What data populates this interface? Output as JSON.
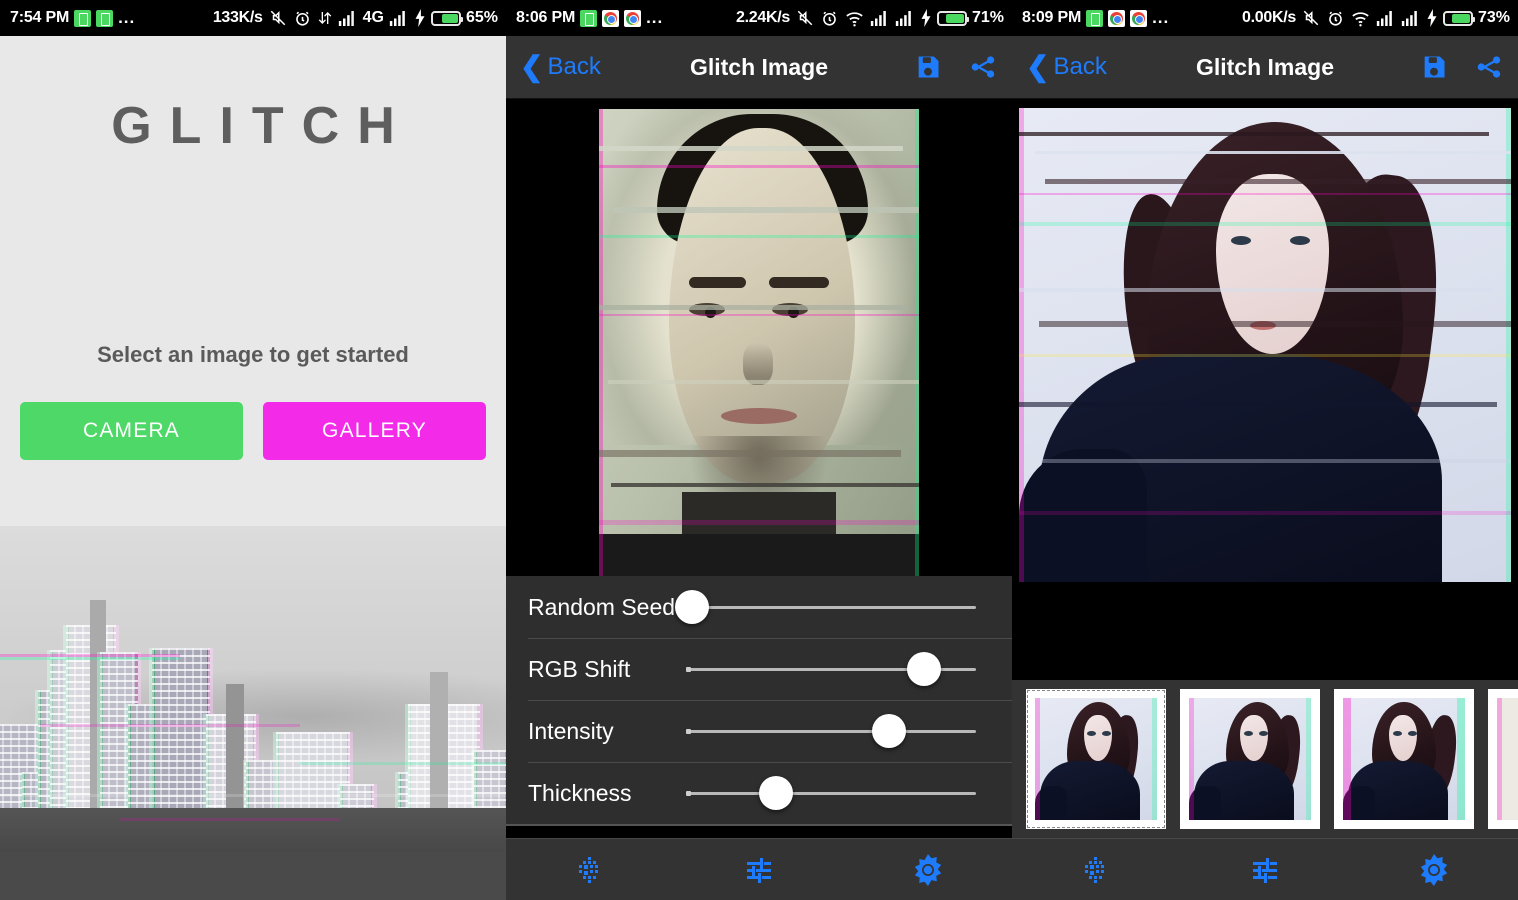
{
  "panels": [
    {
      "statusbar": {
        "time": "7:54 PM",
        "app_icons": [
          "battery-saver-icon",
          "battery-saver-icon"
        ],
        "overflow": "...",
        "net_speed": "133K/s",
        "icons": [
          "mute-icon",
          "alarm-icon",
          "data-transfer-icon",
          "signal-1-icon",
          "4G",
          "signal-2-icon",
          "charging-icon"
        ],
        "network_type": "4G",
        "battery_percent": "65%",
        "battery_level": 65
      },
      "splash": {
        "title": "GLITCH",
        "subtitle": "Select an image to get started",
        "camera_label": "CAMERA",
        "gallery_label": "GALLERY",
        "camera_color": "#4ed868",
        "gallery_color": "#f32ae8",
        "background_color": "#e8e8e8",
        "hero_image": "glitched-cityscape-photo"
      }
    },
    {
      "statusbar": {
        "time": "8:06 PM",
        "app_icons": [
          "battery-saver-icon",
          "chrome-icon",
          "chrome-icon"
        ],
        "overflow": "...",
        "net_speed": "2.24K/s",
        "icons": [
          "mute-icon",
          "alarm-icon",
          "wifi-icon",
          "signal-1-icon",
          "signal-2-icon",
          "charging-icon"
        ],
        "network_type": "",
        "battery_percent": "71%",
        "battery_level": 71
      },
      "appbar": {
        "back_label": "Back",
        "title": "Glitch Image",
        "back_color": "#1e7bfb",
        "accent_color": "#1e7bfb",
        "actions": [
          "save-icon",
          "share-icon"
        ]
      },
      "preview": {
        "image": "glitched-man-portrait"
      },
      "sliders": [
        {
          "label": "Random Seed",
          "value": 2
        },
        {
          "label": "RGB Shift",
          "value": 82
        },
        {
          "label": "Intensity",
          "value": 70
        },
        {
          "label": "Thickness",
          "value": 31
        }
      ],
      "bottomnav": [
        "grain-icon",
        "adjust-sliders-icon",
        "brightness-icon"
      ]
    },
    {
      "statusbar": {
        "time": "8:09 PM",
        "app_icons": [
          "battery-saver-icon",
          "chrome-icon",
          "chrome-icon"
        ],
        "overflow": "...",
        "net_speed": "0.00K/s",
        "icons": [
          "mute-icon",
          "alarm-icon",
          "wifi-icon",
          "signal-1-icon",
          "signal-2-icon",
          "charging-icon"
        ],
        "network_type": "",
        "battery_percent": "73%",
        "battery_level": 73
      },
      "appbar": {
        "back_label": "Back",
        "title": "Glitch Image",
        "back_color": "#1e7bfb",
        "accent_color": "#1e7bfb",
        "actions": [
          "save-icon",
          "share-icon"
        ]
      },
      "preview": {
        "image": "glitched-woman-portrait"
      },
      "thumbnails": [
        {
          "name": "preset-thumbnail-1",
          "selected": true
        },
        {
          "name": "preset-thumbnail-2",
          "selected": false
        },
        {
          "name": "preset-thumbnail-3",
          "selected": false
        },
        {
          "name": "preset-thumbnail-4",
          "selected": false
        }
      ],
      "bottomnav": [
        "grain-icon",
        "adjust-sliders-icon",
        "brightness-icon"
      ]
    }
  ]
}
